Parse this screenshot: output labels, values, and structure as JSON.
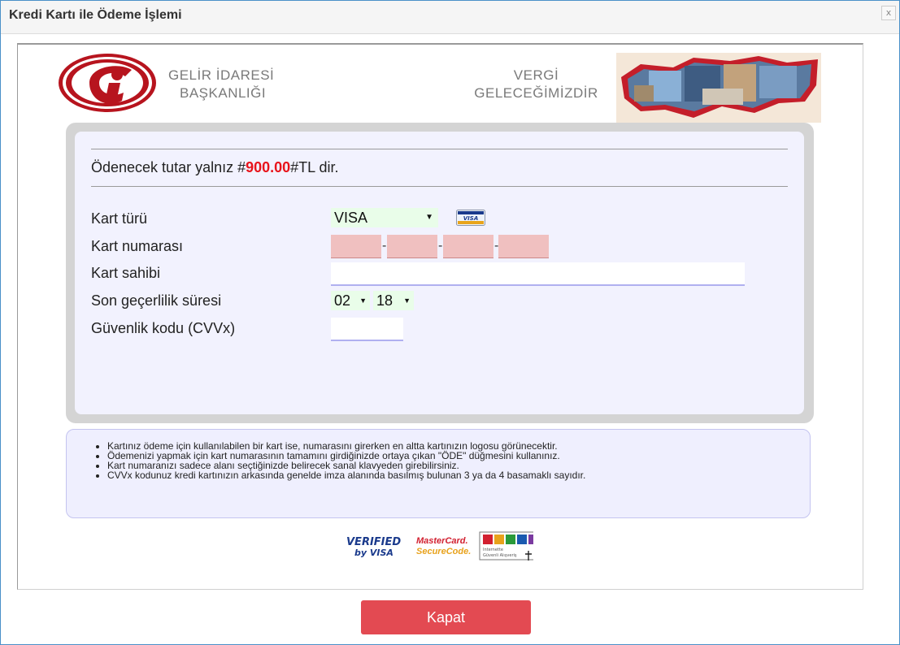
{
  "dialog": {
    "title": "Kredi Kartı ile Ödeme İşlemi",
    "close_label": "x"
  },
  "header": {
    "org_line1": "GELİR İDARESİ",
    "org_line2": "BAŞKANLIĞI",
    "motto_line1": "VERGİ",
    "motto_line2": "GELECEĞİMİZDİR",
    "logo_icon": "gib-logo-icon",
    "map_image": "turkey-map-image"
  },
  "amount": {
    "prefix": "Ödenecek tutar yalnız #",
    "value": "900.00",
    "suffix": "#TL dir."
  },
  "form": {
    "card_type_label": "Kart türü",
    "card_type_value": "VISA",
    "card_number_label": "Kart numarası",
    "card_holder_label": "Kart sahibi",
    "expiry_label": "Son geçerlilik süresi",
    "expiry_month": "02",
    "expiry_year": "18",
    "expiry_separator": "/",
    "cvv_label": "Güvenlik kodu (CVVx)",
    "dash": "-",
    "visa_badge_text": "VISA"
  },
  "info": {
    "items": [
      "Kartınız ödeme için kullanılabilen bir kart ise, numarasını girerken en altta kartınızın logosu görünecektir.",
      "Ödemenizi yapmak için kart numarasının tamamını girdiğinizde ortaya çıkan \"ÖDE\" düğmesini kullanınız.",
      "Kart numaranızı sadece alanı seçtiğinizde belirecek sanal klavyeden girebilirsiniz.",
      "CVVx kodunuz kredi kartınızın arkasında genelde imza alanında basılmış bulunan 3 ya da 4 basamaklı sayıdır."
    ]
  },
  "security_badges": {
    "verified_line1": "VERIFIED",
    "verified_line2": "by VISA",
    "mc_line1": "MasterCard.",
    "mc_line2": "SecureCode.",
    "igs_line1": "Internette",
    "igs_line2": "Güvenli Alışveriş"
  },
  "footer": {
    "close_button_label": "Kapat"
  },
  "colors": {
    "accent_red": "#e34a52",
    "amount_red": "#e8141b",
    "border_blue": "#4a90c8"
  }
}
